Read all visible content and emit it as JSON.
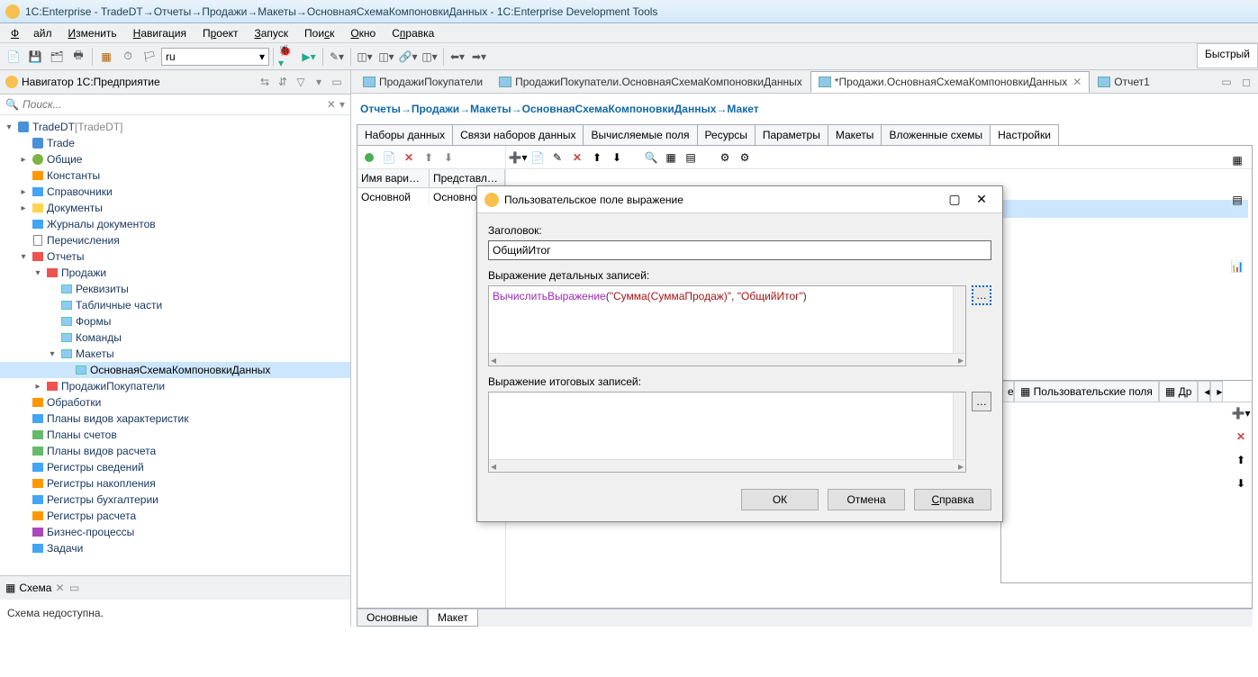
{
  "window": {
    "title": "1C:Enterprise - TradeDT→Отчеты→Продажи→Макеты→ОсновнаяСхемаКомпоновкиДанных - 1C:Enterprise Development Tools"
  },
  "menu": {
    "file": "Файл",
    "edit": "Изменить",
    "nav": "Навигация",
    "proj": "Проект",
    "run": "Запуск",
    "search": "Поиск",
    "window": "Окно",
    "help": "Справка"
  },
  "toolbar": {
    "lang": "ru",
    "quick": "Быстрый"
  },
  "navigator": {
    "title": "Навигатор 1C:Предприятие",
    "search_placeholder": "Поиск...",
    "tree": [
      {
        "l": 0,
        "e": "▾",
        "i": "db",
        "t": "TradeDT",
        "t2": " [TradeDT]"
      },
      {
        "l": 1,
        "e": "",
        "i": "db",
        "t": "Trade"
      },
      {
        "l": 1,
        "e": "▸",
        "i": "g",
        "t": "Общие"
      },
      {
        "l": 1,
        "e": "",
        "i": "o",
        "t": "Константы"
      },
      {
        "l": 1,
        "e": "▸",
        "i": "b",
        "t": "Справочники"
      },
      {
        "l": 1,
        "e": "▸",
        "i": "y",
        "t": "Документы"
      },
      {
        "l": 1,
        "e": "",
        "i": "b",
        "t": "Журналы документов"
      },
      {
        "l": 1,
        "e": "",
        "i": "p",
        "t": "Перечисления"
      },
      {
        "l": 1,
        "e": "▾",
        "i": "r",
        "t": "Отчеты"
      },
      {
        "l": 2,
        "e": "▾",
        "i": "r",
        "t": "Продажи"
      },
      {
        "l": 3,
        "e": "",
        "i": "l",
        "t": "Реквизиты"
      },
      {
        "l": 3,
        "e": "",
        "i": "l",
        "t": "Табличные части"
      },
      {
        "l": 3,
        "e": "",
        "i": "l",
        "t": "Формы"
      },
      {
        "l": 3,
        "e": "",
        "i": "l",
        "t": "Команды"
      },
      {
        "l": 3,
        "e": "▾",
        "i": "l",
        "t": "Макеты"
      },
      {
        "l": 4,
        "e": "",
        "i": "l",
        "t": "ОсновнаяСхемаКомпоновкиДанных",
        "sel": true
      },
      {
        "l": 2,
        "e": "▸",
        "i": "r",
        "t": "ПродажиПокупатели"
      },
      {
        "l": 1,
        "e": "",
        "i": "o",
        "t": "Обработки"
      },
      {
        "l": 1,
        "e": "",
        "i": "b",
        "t": "Планы видов характеристик"
      },
      {
        "l": 1,
        "e": "",
        "i": "g2",
        "t": "Планы счетов"
      },
      {
        "l": 1,
        "e": "",
        "i": "g2",
        "t": "Планы видов расчета"
      },
      {
        "l": 1,
        "e": "",
        "i": "b",
        "t": "Регистры сведений"
      },
      {
        "l": 1,
        "e": "",
        "i": "o",
        "t": "Регистры накопления"
      },
      {
        "l": 1,
        "e": "",
        "i": "b",
        "t": "Регистры бухгалтерии"
      },
      {
        "l": 1,
        "e": "",
        "i": "o",
        "t": "Регистры расчета"
      },
      {
        "l": 1,
        "e": "",
        "i": "p2",
        "t": "Бизнес-процессы"
      },
      {
        "l": 1,
        "e": "",
        "i": "b",
        "t": "Задачи"
      }
    ]
  },
  "schema": {
    "title": "Схема",
    "body": "Схема недоступна."
  },
  "tabs": {
    "t1": "ПродажиПокупатели",
    "t2": "ПродажиПокупатели.ОсновнаяСхемаКомпоновкиДанных",
    "t3": "*Продажи.ОсновнаяСхемаКомпоновкиДанных",
    "t4": "Отчет1"
  },
  "breadcrumb": {
    "p1": "Отчеты",
    "p2": "Продажи",
    "p3": "Макеты",
    "p4": "ОсновнаяСхемаКомпоновкиДанных",
    "p5": "Макет"
  },
  "subtabs": {
    "s1": "Наборы данных",
    "s2": "Связи наборов данных",
    "s3": "Вычисляемые поля",
    "s4": "Ресурсы",
    "s5": "Параметры",
    "s6": "Макеты",
    "s7": "Вложенные схемы",
    "s8": "Настройки"
  },
  "grid": {
    "c1": "Имя вариан...",
    "c2": "Представле...",
    "r1c1": "Основной",
    "r1c2": "Основно..."
  },
  "props": {
    "tab1": "Пользовательские поля",
    "tab2": "Др"
  },
  "bottom": {
    "t1": "Основные",
    "t2": "Макет"
  },
  "dialog": {
    "title": "Пользовательское поле выражение",
    "label_title": "Заголовок:",
    "value_title": "ОбщийИтог",
    "label_detail": "Выражение детальных записей:",
    "label_total": "Выражение итоговых записей:",
    "expr_fn": "ВычислитьВыражение",
    "expr_s1": "\"Сумма(СуммаПродаж)\"",
    "expr_s2": "\"ОбщийИтог\"",
    "btn_ok": "ОК",
    "btn_cancel": "Отмена",
    "btn_help": "Справка"
  }
}
